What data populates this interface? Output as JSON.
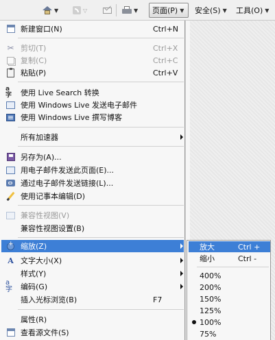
{
  "toolbar": {
    "page_label": "页面(P)",
    "safety_label": "安全(S)",
    "tools_label": "工具(O)"
  },
  "menu": {
    "new_window": {
      "label": "新建窗口(N)",
      "shortcut": "Ctrl+N"
    },
    "cut": {
      "label": "剪切(T)",
      "shortcut": "Ctrl+X"
    },
    "copy": {
      "label": "复制(C)",
      "shortcut": "Ctrl+C"
    },
    "paste": {
      "label": "粘贴(P)",
      "shortcut": "Ctrl+V"
    },
    "translate": {
      "label": "使用 Live Search 转换"
    },
    "email": {
      "label": "使用 Windows Live 发送电子邮件"
    },
    "blog": {
      "label": "使用 Windows Live 撰写博客"
    },
    "accelerators": {
      "label": "所有加速器"
    },
    "save_as": {
      "label": "另存为(A)..."
    },
    "send_page": {
      "label": "用电子邮件发送此页面(E)..."
    },
    "send_link": {
      "label": "通过电子邮件发送链接(L)..."
    },
    "edit_notepad": {
      "label": "使用记事本编辑(D)"
    },
    "compat_view": {
      "label": "兼容性视图(V)"
    },
    "compat_settings": {
      "label": "兼容性视图设置(B)"
    },
    "zoom": {
      "label": "缩放(Z)"
    },
    "text_size": {
      "label": "文字大小(X)"
    },
    "style": {
      "label": "样式(Y)"
    },
    "encoding": {
      "label": "编码(G)"
    },
    "caret_browsing": {
      "label": "插入光标浏览(B)",
      "shortcut": "F7"
    },
    "properties": {
      "label": "属性(R)"
    },
    "view_source": {
      "label": "查看源文件(S)"
    }
  },
  "zoom_submenu": {
    "zoom_in": {
      "label": "放大",
      "shortcut": "Ctrl +"
    },
    "zoom_out": {
      "label": "缩小",
      "shortcut": "Ctrl -"
    },
    "levels": [
      "400%",
      "200%",
      "150%",
      "125%",
      "100%",
      "75%"
    ],
    "selected_level": "100%"
  },
  "colors": {
    "highlight": "#3d7fd6"
  }
}
